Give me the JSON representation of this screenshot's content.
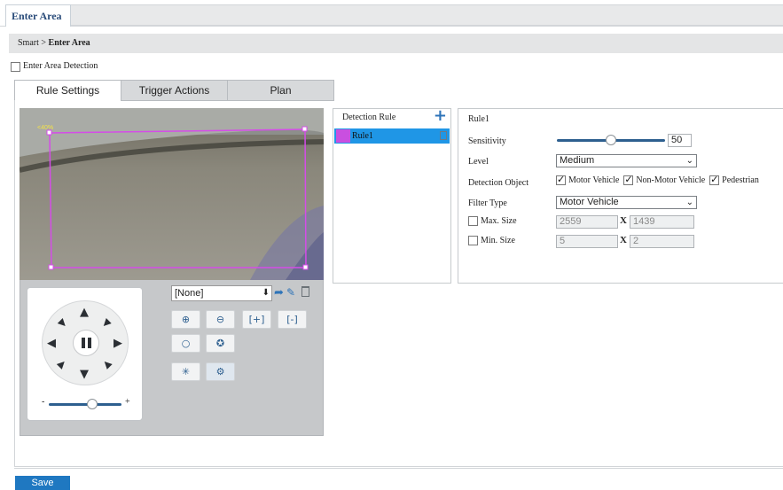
{
  "top_tab": "Enter Area",
  "breadcrumb": {
    "root": "Smart",
    "sep": ">",
    "current": "Enter Area"
  },
  "enable_checkbox": {
    "label": "Enter Area Detection",
    "checked": false
  },
  "tabs": [
    {
      "label": "Rule Settings",
      "active": true
    },
    {
      "label": "Trigger Actions",
      "active": false
    },
    {
      "label": "Plan",
      "active": false
    }
  ],
  "video": {
    "overlay_text": "<40%"
  },
  "ptz": {
    "preset_value": "[None]",
    "zoom_slider_minus": "-",
    "zoom_slider_plus": "+"
  },
  "rule_list": {
    "header": "Detection Rule",
    "rules": [
      {
        "label": "Rule1",
        "color": "#c94fe0",
        "selected": true
      }
    ]
  },
  "rule_settings": {
    "title": "Rule1",
    "sensitivity_label": "Sensitivity",
    "sensitivity_value": "50",
    "sensitivity_fraction": 0.5,
    "level_label": "Level",
    "level_value": "Medium",
    "detection_object_label": "Detection Object",
    "objects": [
      {
        "label": "Motor Vehicle",
        "checked": true
      },
      {
        "label": "Non-Motor Vehicle",
        "checked": true
      },
      {
        "label": "Pedestrian",
        "checked": true
      }
    ],
    "filter_type_label": "Filter Type",
    "filter_type_value": "Motor Vehicle",
    "max_size": {
      "label": "Max. Size",
      "checked": false,
      "w": "2559",
      "x": "X",
      "h": "1439"
    },
    "min_size": {
      "label": "Min. Size",
      "checked": false,
      "w": "5",
      "x": "X",
      "h": "2"
    }
  },
  "save_label": "Save",
  "colors": {
    "accent": "#1f78c1",
    "selected_row": "#1f96e6",
    "rule_line": "#c94fe0"
  }
}
